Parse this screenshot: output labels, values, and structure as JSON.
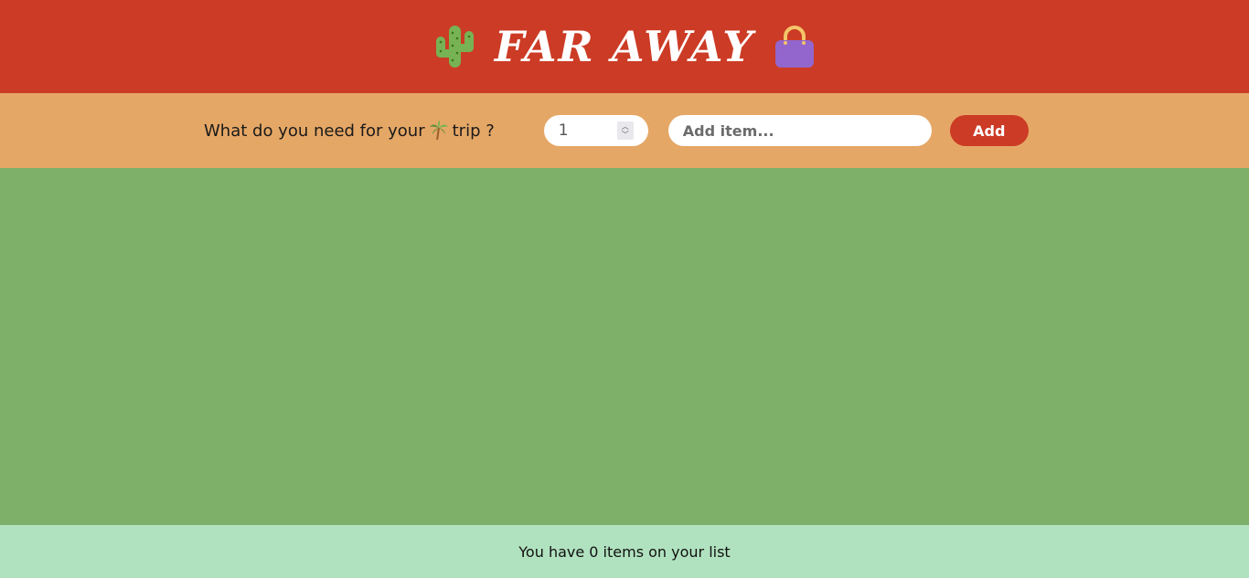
{
  "header": {
    "title": "Far Away",
    "left_icon": "cactus-icon",
    "right_icon": "handbag-icon"
  },
  "form": {
    "prompt_before": "What do you need for your",
    "prompt_icon": "palm-tree-icon",
    "prompt_after": "trip ?",
    "quantity_value": "1",
    "item_placeholder": "Add item...",
    "add_label": "Add"
  },
  "footer": {
    "stats_text": "You have 0 items on your list"
  },
  "colors": {
    "header_bg": "#cc3b25",
    "form_bg": "#e5a766",
    "list_bg": "#7fb069",
    "footer_bg": "#b1e2bf"
  }
}
